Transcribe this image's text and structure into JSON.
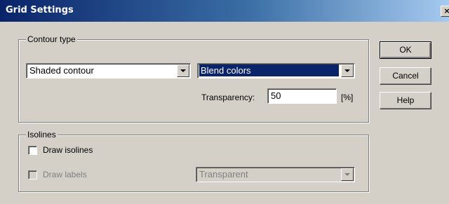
{
  "window": {
    "title": "Grid Settings",
    "close_glyph": "×"
  },
  "contour_group": {
    "legend": "Contour type",
    "type_combo": {
      "value": "Shaded contour"
    },
    "blend_combo": {
      "value": "Blend colors"
    },
    "transparency": {
      "label": "Transparency:",
      "value": "50",
      "unit": "[%]"
    }
  },
  "isolines_group": {
    "legend": "Isolines",
    "draw_isolines": {
      "label": "Draw isolines",
      "checked": false
    },
    "draw_labels": {
      "label": "Draw labels",
      "checked": false,
      "enabled": false
    },
    "label_bg_combo": {
      "value": "Transparent",
      "enabled": false
    }
  },
  "buttons": {
    "ok": "OK",
    "cancel": "Cancel",
    "help": "Help"
  }
}
